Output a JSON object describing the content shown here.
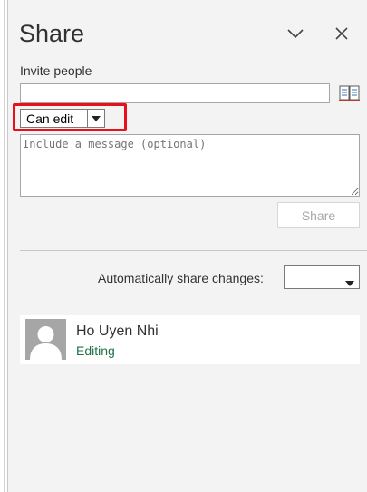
{
  "pane": {
    "title": "Share",
    "header_icons": [
      "chevron-down-icon",
      "close-icon"
    ]
  },
  "invite": {
    "label": "Invite people",
    "input_value": "",
    "address_book_icon": "address-book-icon"
  },
  "permission": {
    "selected": "Can edit",
    "highlighted": true,
    "highlight_color": "#e8101b"
  },
  "message": {
    "placeholder": "Include a message (optional)"
  },
  "share_button": {
    "label": "Share",
    "enabled": false
  },
  "auto_share": {
    "label": "Automatically share changes:",
    "selected": ""
  },
  "people": [
    {
      "name": "Ho Uyen Nhi",
      "status": "Editing",
      "status_color": "#217346",
      "avatar_icon": "person-silhouette-icon"
    }
  ],
  "colors": {
    "pane_bg": "#f3f3f3",
    "accent_green": "#217346"
  }
}
